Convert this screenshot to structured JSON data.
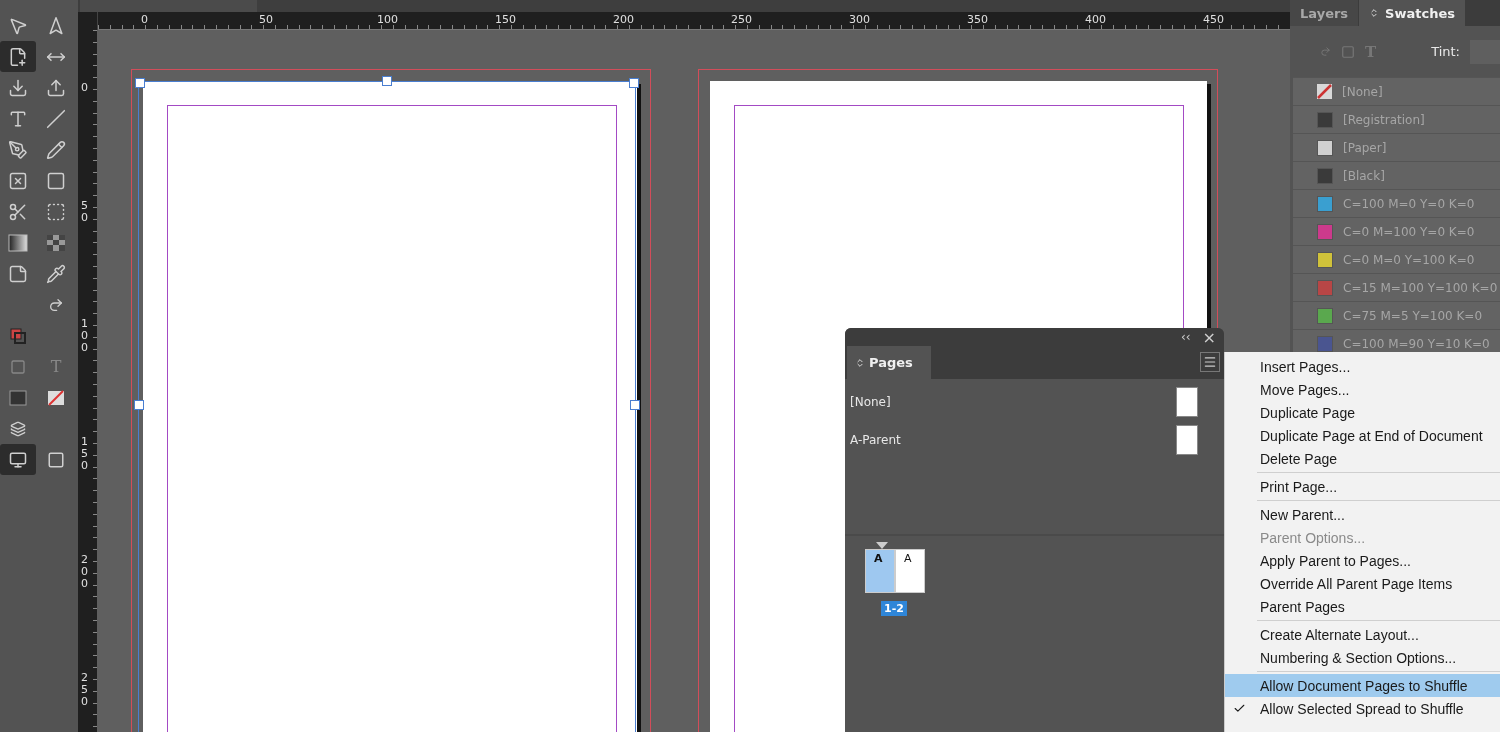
{
  "toolbar": {
    "tools": [
      {
        "selected": false
      },
      {
        "selected": false
      },
      {
        "selected": true
      },
      {
        "selected": false
      },
      {
        "selected": false
      },
      {
        "selected": false
      },
      {
        "selected": false
      },
      {
        "selected": false
      },
      {
        "selected": false
      },
      {
        "selected": false
      },
      {
        "selected": false
      },
      {
        "selected": false
      },
      {
        "selected": false
      },
      {
        "selected": false
      },
      {
        "selected": false
      },
      {
        "selected": false
      },
      {
        "selected": false
      },
      {
        "selected": false
      }
    ],
    "fill_stroke_text": "T",
    "screen_mode_selected": true
  },
  "ruler": {
    "horizontal": [
      "0",
      "50",
      "100",
      "150",
      "200",
      "250",
      "300",
      "350",
      "400",
      "450"
    ],
    "vertical": [
      "0",
      "50",
      "100",
      "150",
      "200",
      "250"
    ]
  },
  "side_panel": {
    "tabs": [
      {
        "label": "Layers",
        "selected": false
      },
      {
        "label": "Swatches",
        "selected": true
      }
    ],
    "text_icon_glyph": "T",
    "tint_label": "Tint:",
    "swatches": [
      {
        "name": "[None]",
        "kind": "none",
        "color": "#d8d8d8"
      },
      {
        "name": "[Registration]",
        "kind": "solid",
        "color": "#3a3a3a"
      },
      {
        "name": "[Paper]",
        "kind": "solid",
        "color": "#d0d0d0"
      },
      {
        "name": "[Black]",
        "kind": "solid",
        "color": "#3a3a3a"
      },
      {
        "name": "C=100 M=0 Y=0 K=0",
        "kind": "solid",
        "color": "#3a9fd0"
      },
      {
        "name": "C=0 M=100 Y=0 K=0",
        "kind": "solid",
        "color": "#cc3a8c"
      },
      {
        "name": "C=0 M=0 Y=100 K=0",
        "kind": "solid",
        "color": "#d0c23a"
      },
      {
        "name": "C=15 M=100 Y=100 K=0",
        "kind": "solid",
        "color": "#b84646"
      },
      {
        "name": "C=75 M=5 Y=100 K=0",
        "kind": "solid",
        "color": "#5aa84e"
      },
      {
        "name": "C=100 M=90 Y=10 K=0",
        "kind": "solid",
        "color": "#4a5590"
      }
    ]
  },
  "pages_panel": {
    "collapse_glyph": "‹‹",
    "close_glyph": "×",
    "tab": {
      "label": "Pages",
      "selected": true
    },
    "parents": [
      {
        "name": "[None]"
      },
      {
        "name": "A-Parent"
      }
    ],
    "spread": {
      "pages": [
        {
          "prefix": "A",
          "selected": true
        },
        {
          "prefix": "A",
          "selected": false
        }
      ],
      "label": "1-2"
    }
  },
  "menu": {
    "groups": [
      [
        {
          "label": "Insert Pages...",
          "disabled": false,
          "selected": false,
          "checked": false
        },
        {
          "label": "Move Pages...",
          "disabled": false,
          "selected": false,
          "checked": false
        },
        {
          "label": "Duplicate Page",
          "disabled": false,
          "selected": false,
          "checked": false
        },
        {
          "label": "Duplicate Page at End of Document",
          "disabled": false,
          "selected": false,
          "checked": false
        },
        {
          "label": "Delete Page",
          "disabled": false,
          "selected": false,
          "checked": false
        }
      ],
      [
        {
          "label": "Print Page...",
          "disabled": false,
          "selected": false,
          "checked": false
        }
      ],
      [
        {
          "label": "New Parent...",
          "disabled": false,
          "selected": false,
          "checked": false
        },
        {
          "label": "Parent Options...",
          "disabled": true,
          "selected": false,
          "checked": false
        },
        {
          "label": "Apply Parent to Pages...",
          "disabled": false,
          "selected": false,
          "checked": false
        },
        {
          "label": "Override All Parent Page Items",
          "disabled": false,
          "selected": false,
          "checked": false
        },
        {
          "label": "Parent Pages",
          "disabled": false,
          "selected": false,
          "checked": false
        }
      ],
      [
        {
          "label": "Create Alternate Layout...",
          "disabled": false,
          "selected": false,
          "checked": false
        },
        {
          "label": "Numbering & Section Options...",
          "disabled": false,
          "selected": false,
          "checked": false
        }
      ],
      [
        {
          "label": "Allow Document Pages to Shuffle",
          "disabled": false,
          "selected": true,
          "checked": false
        },
        {
          "label": "Allow Selected Spread to Shuffle",
          "disabled": false,
          "selected": false,
          "checked": true
        }
      ]
    ]
  }
}
